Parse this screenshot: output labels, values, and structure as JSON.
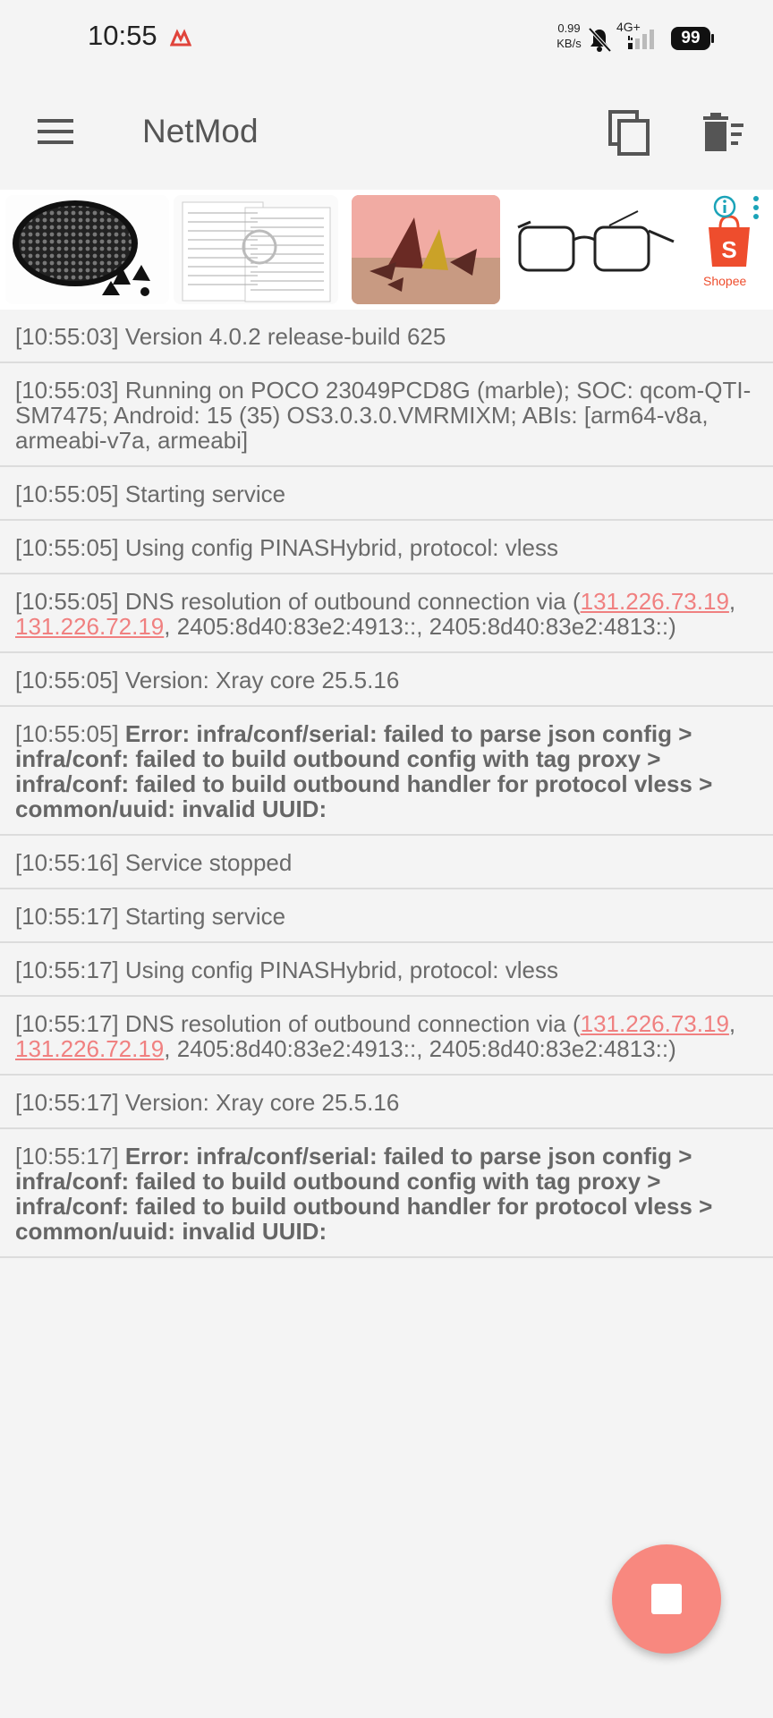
{
  "status": {
    "time": "10:55",
    "net_speed_value": "0.99",
    "net_speed_unit": "KB/s",
    "net_type": "4G+",
    "battery": "99"
  },
  "app_bar": {
    "title": "NetMod"
  },
  "ad": {
    "brand_label": "Shopee"
  },
  "log": [
    {
      "time": "[10:55:03]",
      "text": " Version 4.0.2 release-build 625"
    },
    {
      "time": "[10:55:03]",
      "text": " Running on POCO 23049PCD8G (marble); SOC: qcom-QTI-SM7475; Android: 15 (35) OS3.0.3.0.VMRMIXM; ABIs: [arm64-v8a, armeabi-v7a, armeabi]"
    },
    {
      "time": "[10:55:05]",
      "text": " Starting service"
    },
    {
      "time": "[10:55:05]",
      "text": " Using config PINASHybrid, protocol: vless"
    },
    {
      "time": "[10:55:05]",
      "text": " DNS resolution of outbound connection via (",
      "link1": "131.226.73.19",
      "sep": ", ",
      "link2": "131.226.72.19",
      "rest": ", 2405:8d40:83e2:4913::, 2405:8d40:83e2:4813::)"
    },
    {
      "time": "[10:55:05]",
      "text": " Version: Xray core 25.5.16"
    },
    {
      "time": "[10:55:05]",
      "error": "Error: infra/conf/serial: failed to parse json config > infra/conf: failed to build outbound config with tag proxy > infra/conf: failed to build outbound handler for protocol vless > common/uuid: invalid UUID:"
    },
    {
      "time": "[10:55:16]",
      "text": " Service stopped"
    },
    {
      "time": "[10:55:17]",
      "text": " Starting service"
    },
    {
      "time": "[10:55:17]",
      "text": " Using config PINASHybrid, protocol: vless"
    },
    {
      "time": "[10:55:17]",
      "text": " DNS resolution of outbound connection via (",
      "link1": "131.226.73.19",
      "sep": ", ",
      "link2": "131.226.72.19",
      "rest": ", 2405:8d40:83e2:4913::, 2405:8d40:83e2:4813::)"
    },
    {
      "time": "[10:55:17]",
      "text": " Version: Xray core 25.5.16"
    },
    {
      "time": "[10:55:17]",
      "error": "Error: infra/conf/serial: failed to parse json config > infra/conf: failed to build outbound config with tag proxy > infra/conf: failed to build outbound handler for protocol vless > common/uuid: invalid UUID:"
    }
  ],
  "colors": {
    "accent": "#f8887f",
    "link": "#f08080",
    "background": "#f4f4f4"
  },
  "icons": [
    "menu-icon",
    "copy-icon",
    "clear-log-icon",
    "stop-icon",
    "bell-off-icon",
    "signal-icon",
    "info-icon",
    "more-vert-icon"
  ]
}
